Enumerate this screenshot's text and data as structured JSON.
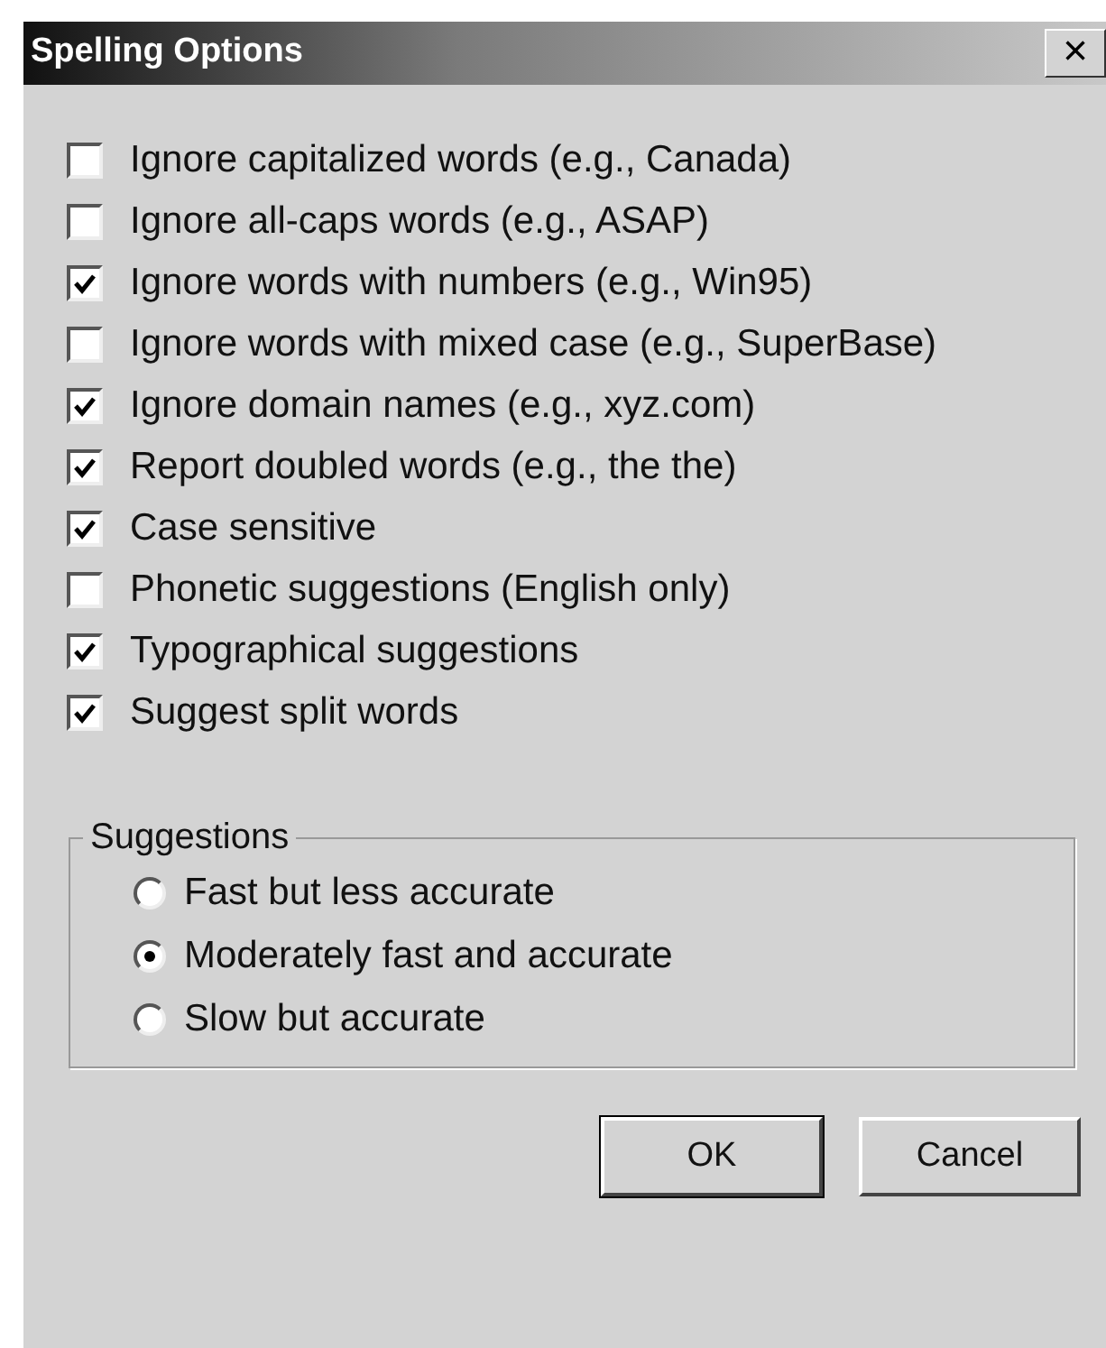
{
  "window": {
    "title": "Spelling Options",
    "close": "×"
  },
  "options": [
    {
      "label": "Ignore capitalized words (e.g., Canada)",
      "checked": false
    },
    {
      "label": "Ignore all-caps words (e.g., ASAP)",
      "checked": false
    },
    {
      "label": "Ignore words with numbers (e.g., Win95)",
      "checked": true
    },
    {
      "label": "Ignore words with mixed case (e.g., SuperBase)",
      "checked": false
    },
    {
      "label": "Ignore domain names (e.g., xyz.com)",
      "checked": true
    },
    {
      "label": "Report doubled words (e.g., the the)",
      "checked": true
    },
    {
      "label": "Case sensitive",
      "checked": true
    },
    {
      "label": "Phonetic suggestions (English only)",
      "checked": false
    },
    {
      "label": "Typographical suggestions",
      "checked": true
    },
    {
      "label": "Suggest split words",
      "checked": true
    }
  ],
  "suggestions": {
    "title": "Suggestions",
    "options": [
      {
        "label": "Fast but less accurate",
        "selected": false
      },
      {
        "label": "Moderately fast and accurate",
        "selected": true
      },
      {
        "label": "Slow but accurate",
        "selected": false
      }
    ]
  },
  "buttons": [
    "OK",
    "Cancel"
  ]
}
